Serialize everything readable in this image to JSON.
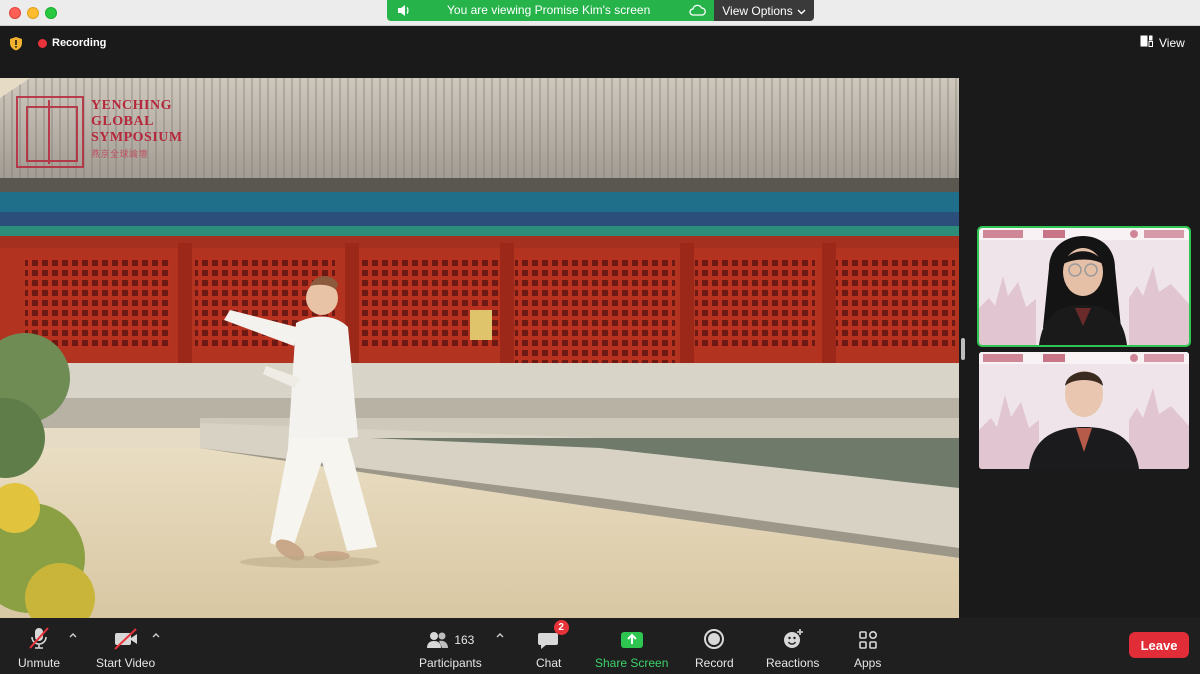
{
  "share_banner": {
    "text": "You are viewing Promise Kim's screen",
    "view_options": "View Options"
  },
  "topbar": {
    "recording": "Recording",
    "view": "View"
  },
  "content": {
    "logo_line1": "YENCHING",
    "logo_line2": "GLOBAL",
    "logo_line3": "SYMPOSIUM",
    "logo_sub": "燕京全球論壇"
  },
  "toolbar": {
    "unmute": "Unmute",
    "start_video": "Start Video",
    "participants": "Participants",
    "participants_count": "163",
    "chat": "Chat",
    "chat_badge": "2",
    "share_screen": "Share Screen",
    "record": "Record",
    "reactions": "Reactions",
    "apps": "Apps",
    "leave": "Leave"
  },
  "colors": {
    "share_green": "#25b34a",
    "leave_red": "#e02d37",
    "active_speaker": "#2ec551",
    "recording_dot": "#e8333a"
  }
}
